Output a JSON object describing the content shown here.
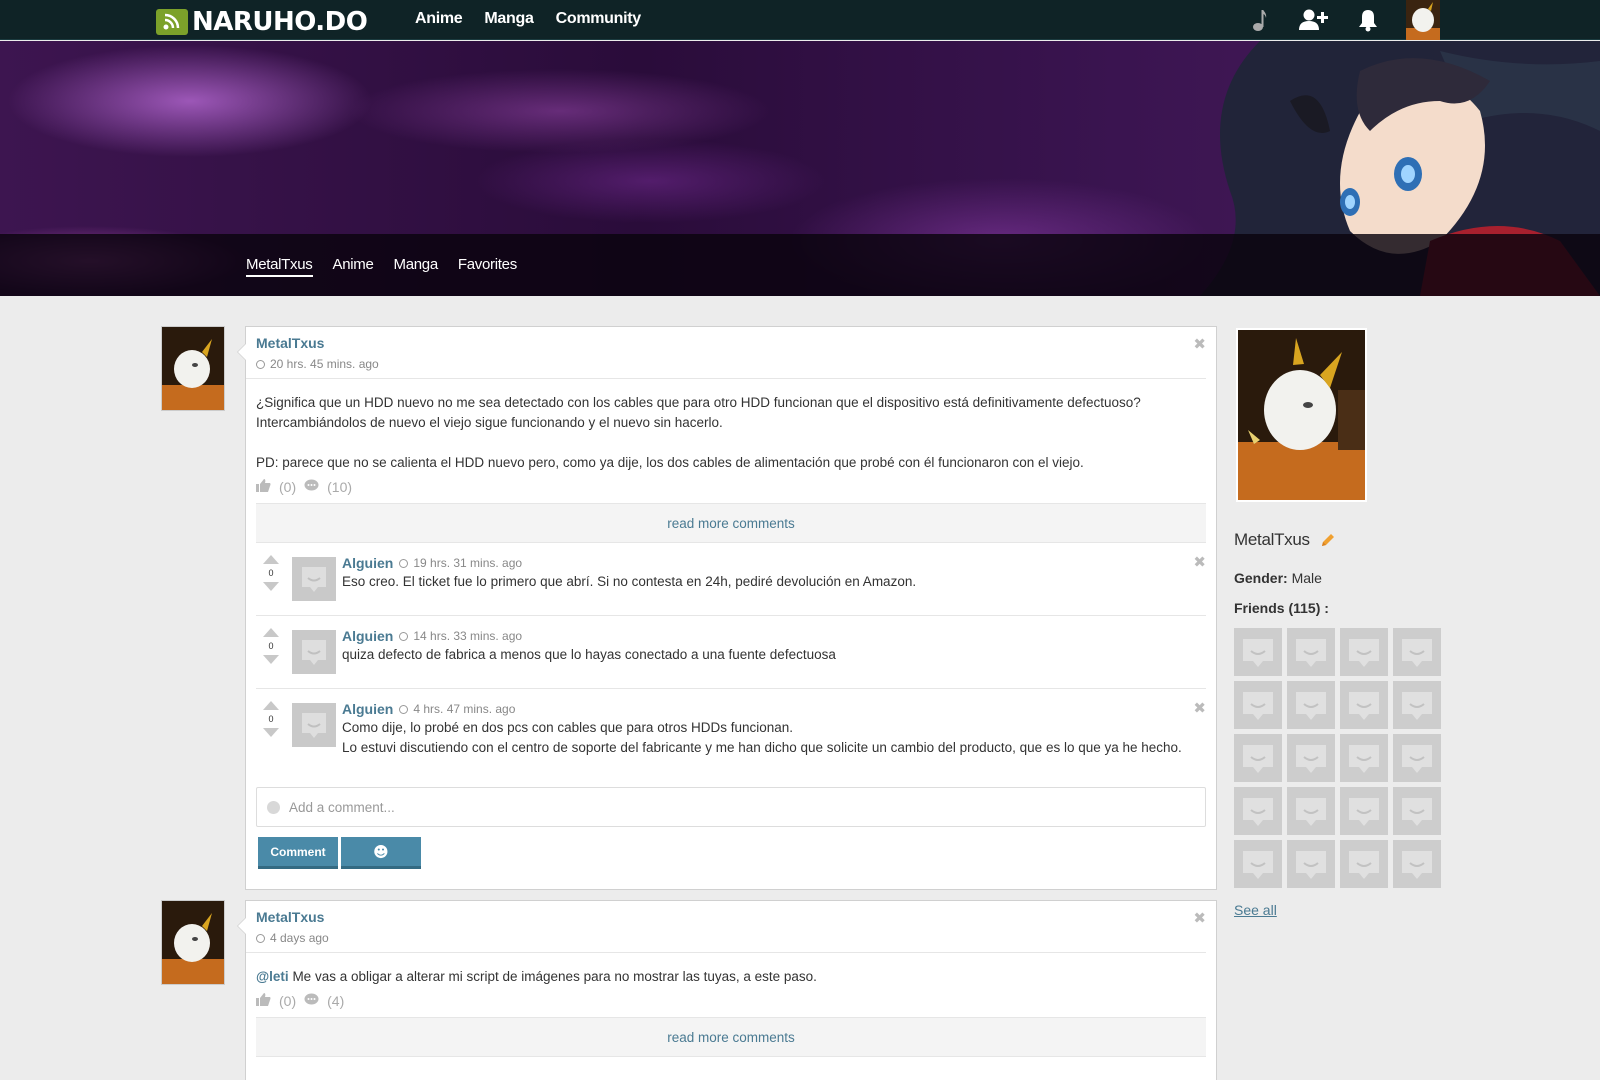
{
  "header": {
    "logo": "NARUHO.DO",
    "nav": [
      "Anime",
      "Manga",
      "Community"
    ],
    "icons": [
      "music-note-icon",
      "add-friend-icon",
      "bell-icon",
      "user-avatar"
    ]
  },
  "profile_nav": {
    "items": [
      "MetalTxus",
      "Anime",
      "Manga",
      "Favorites"
    ],
    "active": "MetalTxus"
  },
  "posts": [
    {
      "author": "MetalTxus",
      "time": "20 hrs. 45 mins. ago",
      "body": [
        "¿Significa que un HDD nuevo no me sea detectado con los cables que para otro HDD funcionan que el dispositivo está definitivamente defectuoso?",
        "Intercambiándolos de nuevo el viejo sigue funcionando y el nuevo sin hacerlo.",
        "PD: parece que no se calienta el HDD nuevo pero, como ya dije, los dos cables de alimentación que probé con él funcionaron con el viejo."
      ],
      "likes": "(0)",
      "comments_count": "(10)",
      "read_more": "read more comments",
      "comments": [
        {
          "author": "Alguien",
          "time": "19 hrs. 31 mins. ago",
          "votes": "0",
          "text": [
            "Eso creo. El ticket fue lo primero que abrí. Si no contesta en 24h, pediré devolución en Amazon."
          ]
        },
        {
          "author": "Alguien",
          "time": "14 hrs. 33 mins. ago",
          "votes": "0",
          "text": [
            "quiza defecto de fabrica a menos que lo hayas conectado a una fuente defectuosa"
          ]
        },
        {
          "author": "Alguien",
          "time": "4 hrs. 47 mins. ago",
          "votes": "0",
          "text": [
            "Como dije, lo probé en dos pcs con cables que para otros HDDs funcionan.",
            "Lo estuvi discutiendo con el centro de soporte del fabricante y me han dicho que solicite un cambio del producto, que es lo que ya he hecho."
          ]
        }
      ],
      "add_comment_placeholder": "Add a comment...",
      "comment_button": "Comment",
      "emoji_button": "☻"
    },
    {
      "author": "MetalTxus",
      "time": "4 days ago",
      "mention": "@leti",
      "body_text": "Me vas a obligar a alterar mi script de imágenes para no mostrar las tuyas, a este paso.",
      "likes": "(0)",
      "comments_count": "(4)",
      "read_more": "read more comments"
    }
  ],
  "sidebar": {
    "name": "MetalTxus",
    "gender_label": "Gender:",
    "gender": "Male",
    "friends_label": "Friends (115) :",
    "friends_shown": 20,
    "see_all": "See all"
  },
  "colors": {
    "topbar": "#0f2326",
    "accent_link": "#4a7a92",
    "button": "#4a8aa8",
    "logo_green": "#7ca12a"
  }
}
